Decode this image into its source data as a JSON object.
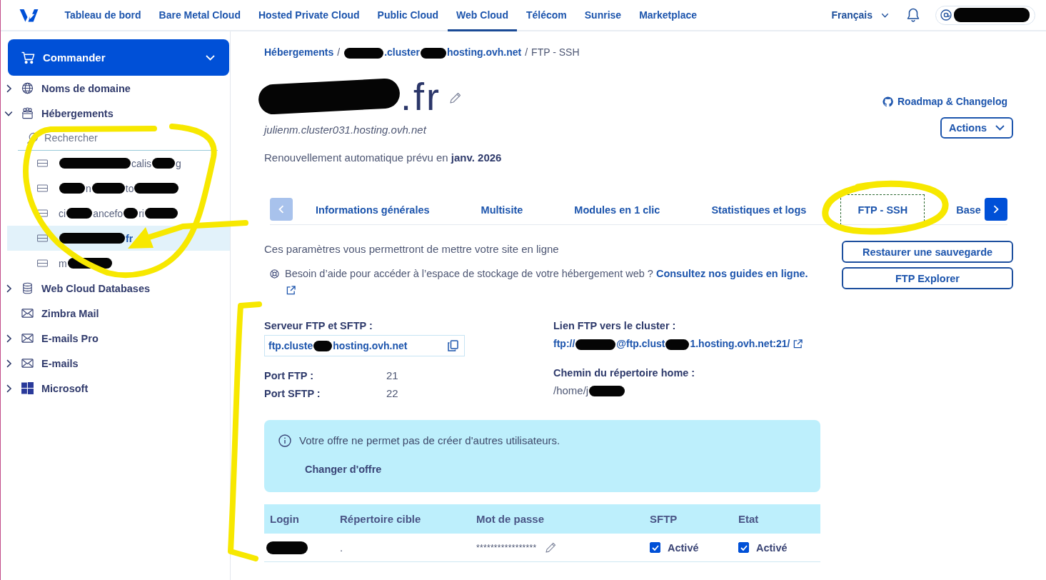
{
  "top_nav": {
    "items": [
      {
        "label": "Tableau de bord",
        "selected": false
      },
      {
        "label": "Bare Metal Cloud",
        "selected": false
      },
      {
        "label": "Hosted Private Cloud",
        "selected": false
      },
      {
        "label": "Public Cloud",
        "selected": false
      },
      {
        "label": "Web Cloud",
        "selected": true
      },
      {
        "label": "Télécom",
        "selected": false
      },
      {
        "label": "Sunrise",
        "selected": false
      },
      {
        "label": "Marketplace",
        "selected": false
      }
    ],
    "language": "Français",
    "account": {
      "segments": [
        {
          "kind": "redaction"
        }
      ]
    }
  },
  "sidebar": {
    "order_button": "Commander",
    "items": [
      {
        "kind": "group",
        "label": "Noms de domaine",
        "expanded": false
      },
      {
        "kind": "group",
        "label": "Hébergements",
        "expanded": true,
        "search": {
          "placeholder": "Rechercher"
        },
        "children": [
          {
            "segments": [
              {
                "kind": "redaction"
              },
              {
                "kind": "text",
                "text": "calis"
              },
              {
                "kind": "redaction"
              },
              {
                "kind": "text",
                "text": "g"
              }
            ],
            "selected": false
          },
          {
            "segments": [
              {
                "kind": "redaction"
              },
              {
                "kind": "text",
                "text": "n"
              },
              {
                "kind": "redaction"
              },
              {
                "kind": "text",
                "text": "to"
              },
              {
                "kind": "redaction"
              }
            ],
            "selected": false
          },
          {
            "segments": [
              {
                "kind": "text",
                "text": "ci"
              },
              {
                "kind": "redaction"
              },
              {
                "kind": "text",
                "text": "ancefo"
              },
              {
                "kind": "redaction"
              },
              {
                "kind": "text",
                "text": "ri"
              },
              {
                "kind": "redaction"
              }
            ],
            "selected": false
          },
          {
            "segments": [
              {
                "kind": "redaction"
              },
              {
                "kind": "text",
                "text": "fr"
              }
            ],
            "selected": true
          },
          {
            "segments": [
              {
                "kind": "text",
                "text": "m"
              },
              {
                "kind": "redaction"
              }
            ],
            "selected": false
          }
        ]
      },
      {
        "kind": "group",
        "label": "Web Cloud Databases",
        "expanded": false
      },
      {
        "kind": "link",
        "label": "Zimbra Mail"
      },
      {
        "kind": "group",
        "label": "E-mails Pro",
        "expanded": false
      },
      {
        "kind": "group",
        "label": "E-mails",
        "expanded": false
      },
      {
        "kind": "group",
        "label": "Microsoft",
        "expanded": false
      }
    ]
  },
  "breadcrumb": [
    {
      "kind": "link",
      "segments": [
        {
          "kind": "text",
          "text": "Hébergements"
        }
      ]
    },
    {
      "kind": "separator",
      "text": "/"
    },
    {
      "kind": "link",
      "segments": [
        {
          "kind": "redaction"
        },
        {
          "kind": "text",
          "text": ".cluster"
        },
        {
          "kind": "redaction"
        },
        {
          "kind": "text",
          "text": "hosting.ovh.net"
        }
      ]
    },
    {
      "kind": "separator",
      "text": "/"
    },
    {
      "kind": "current",
      "text": "FTP - SSH"
    }
  ],
  "header": {
    "title": {
      "segments": [
        {
          "kind": "redaction"
        },
        {
          "kind": "text",
          "text": ".fr"
        }
      ]
    },
    "subtitle": "julienm.cluster031.hosting.ovh.net",
    "renewal": "Renouvellement automatique prévu en **janv. 2026**",
    "roadmap_link": "Roadmap & Changelog",
    "actions_button": "Actions"
  },
  "tabs": {
    "prev_disabled": true,
    "next_disabled": false,
    "items": [
      {
        "label": "Informations générales",
        "selected": false
      },
      {
        "label": "Multisite",
        "selected": false
      },
      {
        "label": "Modules en 1 clic",
        "selected": false
      },
      {
        "label": "Statistiques et logs",
        "selected": false
      },
      {
        "label": "FTP - SSH",
        "selected": true
      },
      {
        "label": "Base",
        "selected": false
      }
    ]
  },
  "content": {
    "intro": "Ces paramètres vous permettront de mettre votre site en ligne",
    "help": {
      "text": "Besoin d’aide pour accéder à l’espace de stockage de votre hébergement web ?",
      "link": "Consultez nos guides en ligne."
    },
    "server": {
      "label": "Serveur FTP et SFTP :",
      "segments": [
        {
          "kind": "text",
          "text": "ftp.cluste"
        },
        {
          "kind": "redaction"
        },
        {
          "kind": "text",
          "text": "hosting.ovh.net"
        }
      ]
    },
    "ports": [
      {
        "label": "Port FTP :",
        "value": "21"
      },
      {
        "label": "Port SFTP :",
        "value": "22"
      }
    ],
    "cluster_link": {
      "label": "Lien FTP vers le cluster :",
      "segments": [
        {
          "kind": "text",
          "text": "ftp://"
        },
        {
          "kind": "redaction"
        },
        {
          "kind": "text",
          "text": "@ftp.clust"
        },
        {
          "kind": "redaction"
        },
        {
          "kind": "text",
          "text": "1.hosting.ovh.net:21/"
        }
      ]
    },
    "home_path": {
      "label": "Chemin du répertoire home :",
      "segments": [
        {
          "kind": "text",
          "text": "/home/j"
        },
        {
          "kind": "redaction"
        }
      ]
    }
  },
  "side_buttons": [
    "Restaurer une sauvegarde",
    "FTP Explorer"
  ],
  "notice": {
    "text": "Votre offre ne permet pas de créer d'autres utilisateurs.",
    "link": "Changer d'offre"
  },
  "table": {
    "columns": [
      "Login",
      "Répertoire cible",
      "Mot de passe",
      "SFTP",
      "Etat"
    ],
    "rows": [
      {
        "login": {
          "segments": [
            {
              "kind": "redaction"
            }
          ]
        },
        "target_dir": ".",
        "password": "*****************",
        "sftp": {
          "checked": true,
          "label": "Activé"
        },
        "state": {
          "checked": true,
          "label": "Activé"
        }
      }
    ]
  }
}
